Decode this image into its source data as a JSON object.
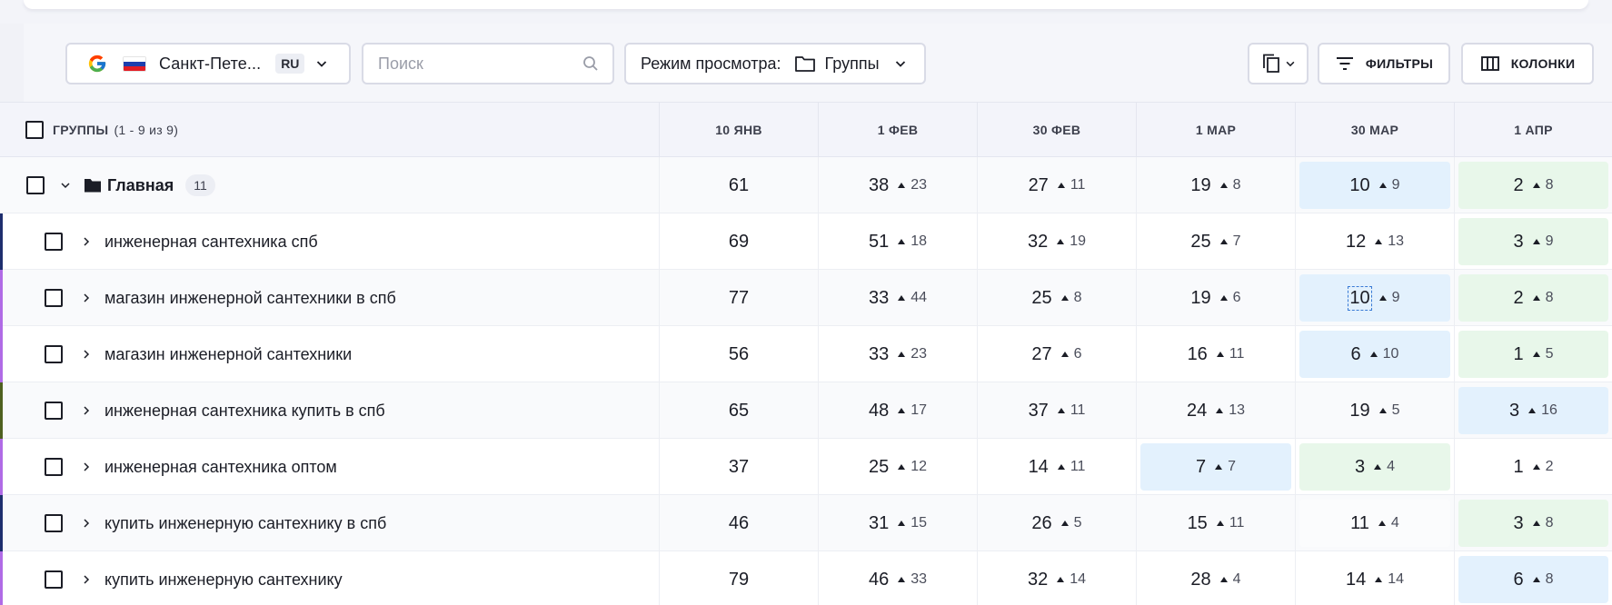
{
  "toolbar": {
    "location": {
      "name": "Санкт-Пете...",
      "lang": "RU",
      "flag_colors": [
        "#ffffff",
        "#1c3fae",
        "#e21c24"
      ]
    },
    "search": {
      "placeholder": "Поиск"
    },
    "view_mode": {
      "label": "Режим просмотра:",
      "value": "Группы"
    },
    "filters_label": "ФИЛЬТРЫ",
    "columns_label": "КОЛОНКИ"
  },
  "table": {
    "header": {
      "groups_label": "ГРУППЫ",
      "groups_count": "(1 - 9 из 9)",
      "dates": [
        "10 ЯНВ",
        "1 ФЕВ",
        "30 ФЕВ",
        "1 МАР",
        "30 МАР",
        "1 АПР"
      ]
    },
    "colors": {
      "blue": "#e3f1fd",
      "green": "#e8f7ea",
      "stripe_navy": "#1e2e6e",
      "stripe_violet": "#b06be6",
      "stripe_olive": "#4f6120"
    },
    "rows": [
      {
        "type": "main",
        "name": "Главная",
        "count": "11",
        "stripe": "",
        "cells": [
          {
            "v": "61",
            "d": "",
            "bg": ""
          },
          {
            "v": "38",
            "d": "23",
            "bg": ""
          },
          {
            "v": "27",
            "d": "11",
            "bg": ""
          },
          {
            "v": "19",
            "d": "8",
            "bg": ""
          },
          {
            "v": "10",
            "d": "9",
            "bg": "blue"
          },
          {
            "v": "2",
            "d": "8",
            "bg": "green"
          }
        ]
      },
      {
        "type": "sub",
        "name": "инженерная сантехника спб",
        "stripe": "stripe_navy",
        "cells": [
          {
            "v": "69",
            "d": "",
            "bg": ""
          },
          {
            "v": "51",
            "d": "18",
            "bg": ""
          },
          {
            "v": "32",
            "d": "19",
            "bg": ""
          },
          {
            "v": "25",
            "d": "7",
            "bg": ""
          },
          {
            "v": "12",
            "d": "13",
            "bg": ""
          },
          {
            "v": "3",
            "d": "9",
            "bg": "green"
          }
        ]
      },
      {
        "type": "sub",
        "name": "магазин инженерной сантехники в спб",
        "stripe": "stripe_violet",
        "cells": [
          {
            "v": "77",
            "d": "",
            "bg": ""
          },
          {
            "v": "33",
            "d": "44",
            "bg": ""
          },
          {
            "v": "25",
            "d": "8",
            "bg": ""
          },
          {
            "v": "19",
            "d": "6",
            "bg": ""
          },
          {
            "v": "10",
            "d": "9",
            "bg": "blue",
            "focus": true
          },
          {
            "v": "2",
            "d": "8",
            "bg": "green"
          }
        ]
      },
      {
        "type": "sub",
        "name": "магазин инженерной сантехники",
        "stripe": "stripe_violet",
        "cells": [
          {
            "v": "56",
            "d": "",
            "bg": ""
          },
          {
            "v": "33",
            "d": "23",
            "bg": ""
          },
          {
            "v": "27",
            "d": "6",
            "bg": ""
          },
          {
            "v": "16",
            "d": "11",
            "bg": ""
          },
          {
            "v": "6",
            "d": "10",
            "bg": "blue"
          },
          {
            "v": "1",
            "d": "5",
            "bg": "green"
          }
        ]
      },
      {
        "type": "sub",
        "name": "инженерная сантехника купить в спб",
        "stripe": "stripe_olive",
        "cells": [
          {
            "v": "65",
            "d": "",
            "bg": ""
          },
          {
            "v": "48",
            "d": "17",
            "bg": ""
          },
          {
            "v": "37",
            "d": "11",
            "bg": ""
          },
          {
            "v": "24",
            "d": "13",
            "bg": ""
          },
          {
            "v": "19",
            "d": "5",
            "bg": ""
          },
          {
            "v": "3",
            "d": "16",
            "bg": "blue"
          }
        ]
      },
      {
        "type": "sub",
        "name": "инженерная сантехника оптом",
        "stripe": "stripe_violet",
        "cells": [
          {
            "v": "37",
            "d": "",
            "bg": ""
          },
          {
            "v": "25",
            "d": "12",
            "bg": ""
          },
          {
            "v": "14",
            "d": "11",
            "bg": ""
          },
          {
            "v": "7",
            "d": "7",
            "bg": "blue"
          },
          {
            "v": "3",
            "d": "4",
            "bg": "green"
          },
          {
            "v": "1",
            "d": "2",
            "bg": ""
          }
        ]
      },
      {
        "type": "sub",
        "name": "купить инженерную сантехнику в спб",
        "stripe": "stripe_navy",
        "cells": [
          {
            "v": "46",
            "d": "",
            "bg": ""
          },
          {
            "v": "31",
            "d": "15",
            "bg": ""
          },
          {
            "v": "26",
            "d": "5",
            "bg": ""
          },
          {
            "v": "15",
            "d": "11",
            "bg": ""
          },
          {
            "v": "11",
            "d": "4",
            "bg": "pale"
          },
          {
            "v": "3",
            "d": "8",
            "bg": "green"
          }
        ]
      },
      {
        "type": "sub",
        "name": "купить инженерную сантехнику",
        "stripe": "stripe_violet",
        "cells": [
          {
            "v": "79",
            "d": "",
            "bg": ""
          },
          {
            "v": "46",
            "d": "33",
            "bg": ""
          },
          {
            "v": "32",
            "d": "14",
            "bg": ""
          },
          {
            "v": "28",
            "d": "4",
            "bg": ""
          },
          {
            "v": "14",
            "d": "14",
            "bg": ""
          },
          {
            "v": "6",
            "d": "8",
            "bg": "blue"
          }
        ]
      }
    ]
  }
}
